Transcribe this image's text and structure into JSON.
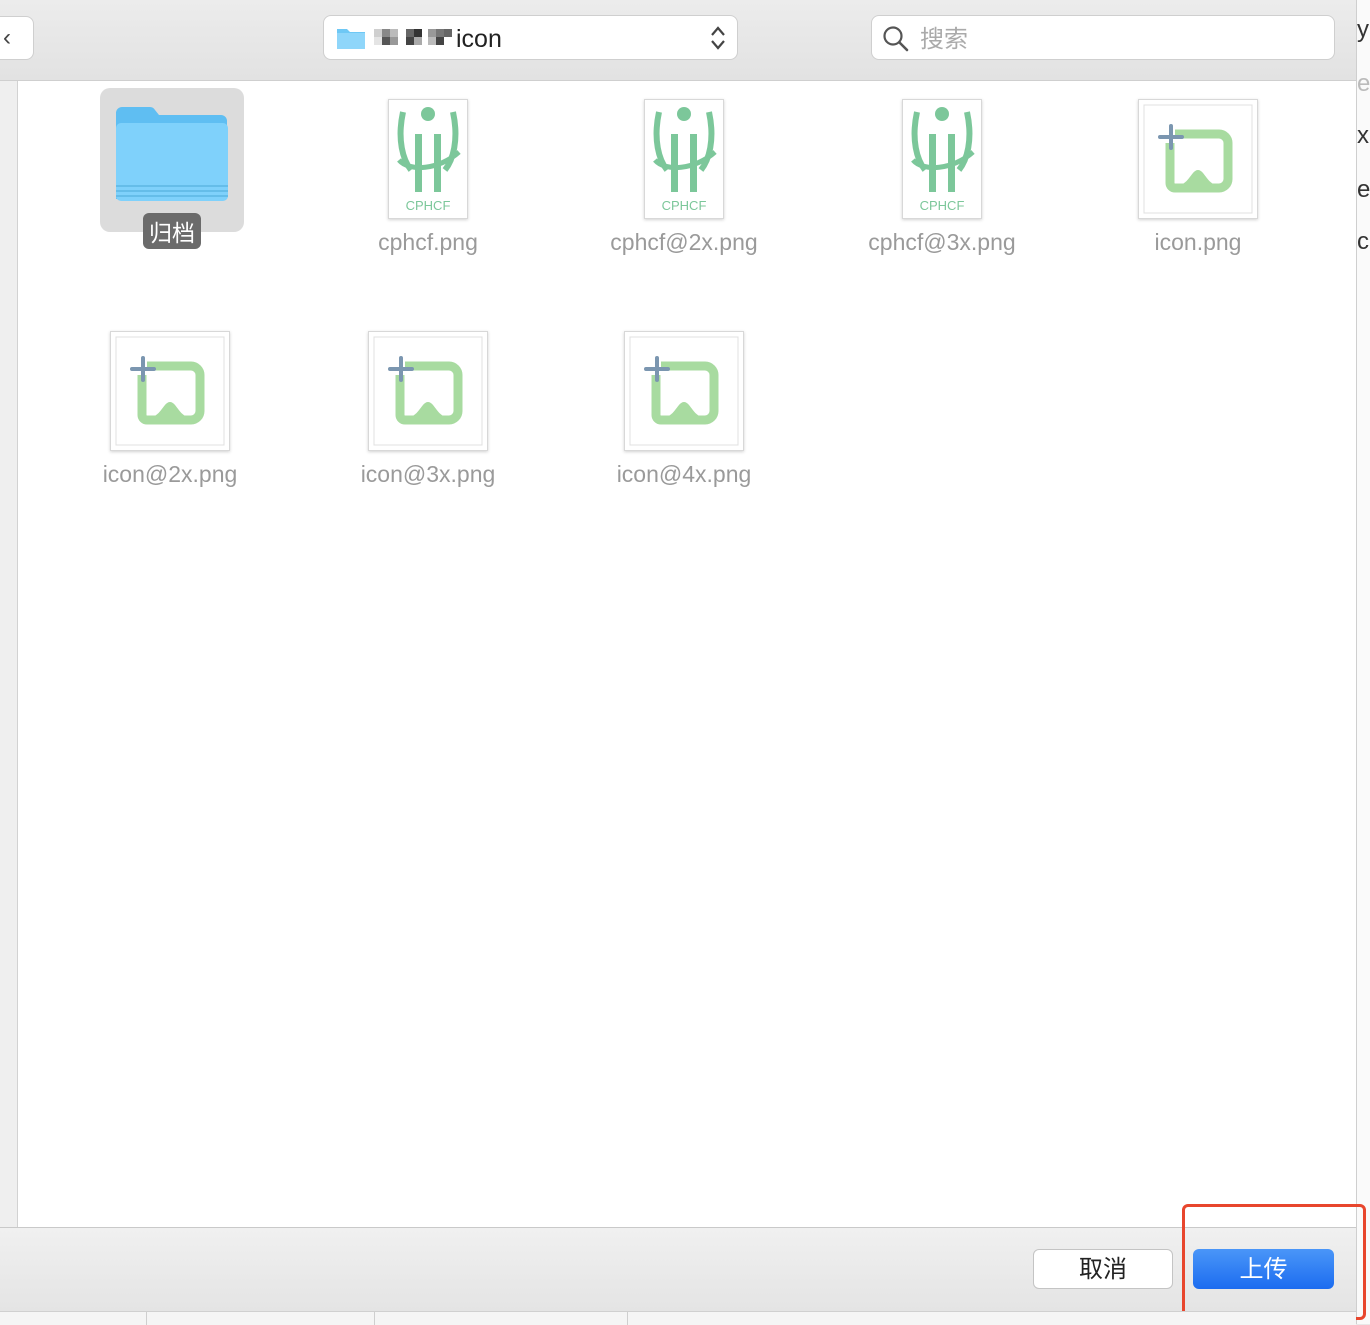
{
  "toolbar": {
    "back_label": "‹",
    "path_label": "icon",
    "search_placeholder": "搜索"
  },
  "files": [
    {
      "name": "归档",
      "kind": "folder",
      "selected": true
    },
    {
      "name": "cphcf.png",
      "kind": "cphcf"
    },
    {
      "name": "cphcf@2x.png",
      "kind": "cphcf"
    },
    {
      "name": "cphcf@3x.png",
      "kind": "cphcf"
    },
    {
      "name": "icon.png",
      "kind": "app-icon"
    },
    {
      "name": "icon@2x.png",
      "kind": "app-icon"
    },
    {
      "name": "icon@3x.png",
      "kind": "app-icon"
    },
    {
      "name": "icon@4x.png",
      "kind": "app-icon"
    }
  ],
  "thumbnail_text": "CPHCF",
  "buttons": {
    "cancel": "取消",
    "upload": "上传"
  },
  "colors": {
    "accent": "#1c6cf0",
    "highlight": "#e8462d",
    "folder": "#6ec8f5",
    "logo_green": "#7cc79a"
  }
}
